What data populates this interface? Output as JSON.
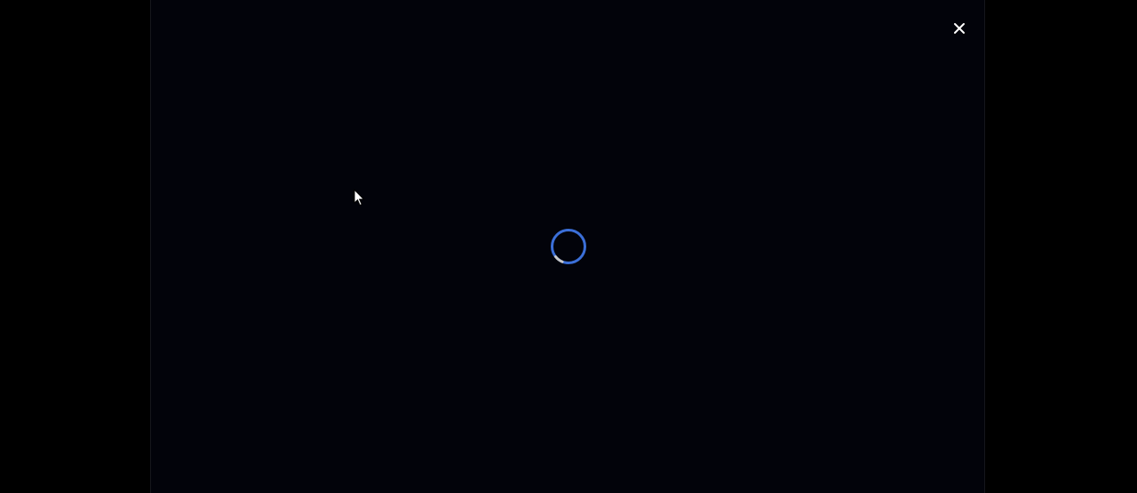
{
  "viewer": {
    "state": "loading",
    "background_color": "#02030a"
  },
  "controls": {
    "close_icon": "close-icon",
    "close_color": "#ffffff"
  },
  "loading_indicator": {
    "icon": "spinner-icon",
    "accent_color": "#3b6fd8",
    "secondary_color": "#c8c8c8"
  },
  "pointer": {
    "icon": "mouse-pointer-icon"
  }
}
